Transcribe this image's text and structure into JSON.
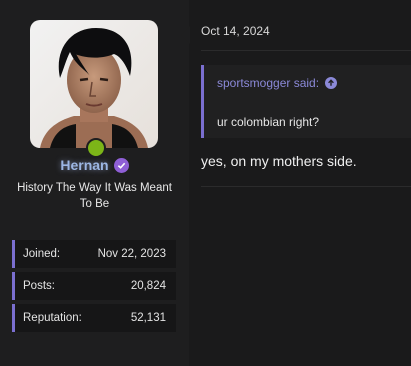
{
  "user": {
    "name": "Hernan",
    "title": "History The Way It Was Meant To Be",
    "online_color": "#7cb518",
    "verified_color": "#8f5fd6"
  },
  "stats": [
    {
      "label": "Joined:",
      "value": "Nov 22, 2023"
    },
    {
      "label": "Posts:",
      "value": "20,824"
    },
    {
      "label": "Reputation:",
      "value": "52,131"
    }
  ],
  "post": {
    "date": "Oct 14, 2024",
    "quote": {
      "author_line": "sportsmogger said:",
      "text": "ur colombian right?"
    },
    "message": "yes, on my mothers side."
  },
  "colors": {
    "accent": "#7b6fd0",
    "background": "#1a1a1b"
  }
}
